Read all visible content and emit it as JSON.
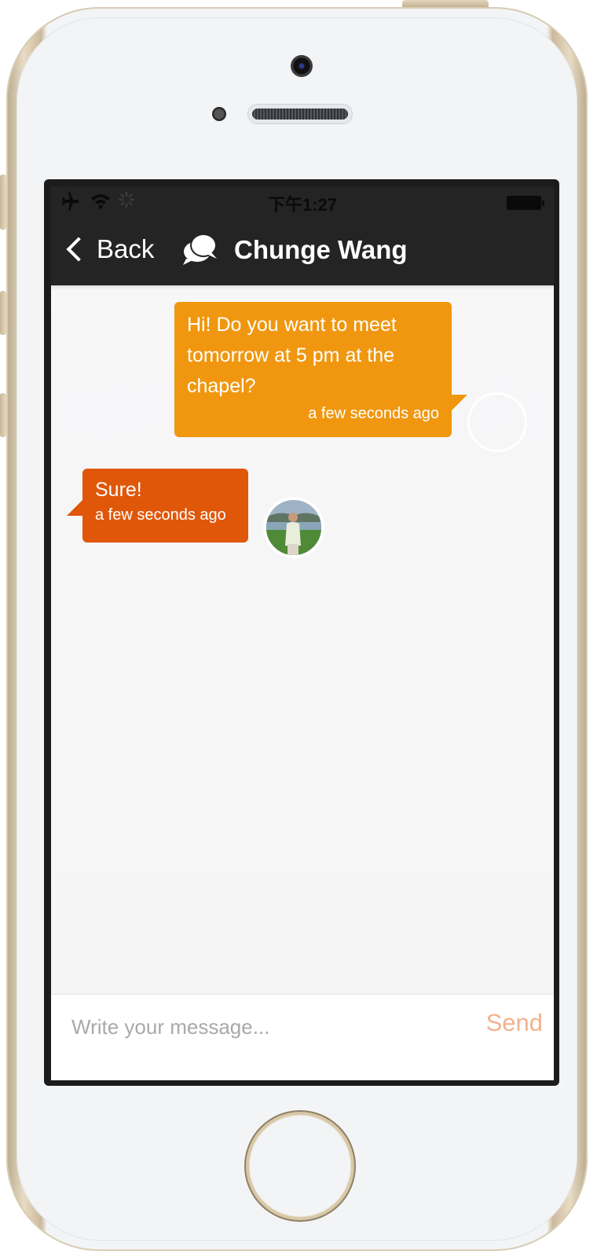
{
  "status_bar": {
    "time": "下午1:27",
    "airplane_icon": "airplane-icon",
    "wifi_icon": "wifi-icon",
    "activity_icon": "activity-spinner-icon",
    "battery_icon": "battery-icon"
  },
  "nav": {
    "back_label": "Back",
    "title": "Chunge Wang",
    "chat_icon": "chat-bubbles-icon"
  },
  "messages": [
    {
      "direction": "outgoing",
      "text": "Hi! Do you want to meet tomorrow at 5 pm at the chapel?",
      "time": "a few seconds ago",
      "color": "#f0970f"
    },
    {
      "direction": "incoming",
      "text": "Sure!",
      "time": "a few seconds ago",
      "color": "#e0570a"
    }
  ],
  "composer": {
    "placeholder": "Write your message...",
    "send_label": "Send",
    "send_color": "#f2b28e"
  },
  "colors": {
    "nav_background": "#242424",
    "chat_background": "#f6f6f7"
  }
}
